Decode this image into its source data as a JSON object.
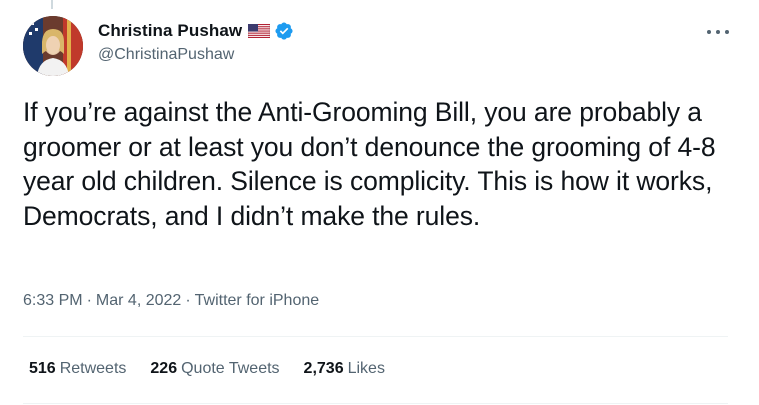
{
  "author": {
    "display_name": "Christina Pushaw",
    "handle": "@ChristinaPushaw",
    "flag": "us-flag-icon",
    "verified": "verified-badge-icon"
  },
  "tweet": {
    "text": "If you’re against the Anti-Grooming Bill, you are probably a groomer or at least you don’t denounce the grooming of 4-8 year old children. Silence is complicity. This is how it works, Democrats, and I didn’t make the rules.",
    "time": "6:33 PM",
    "separator": "·",
    "date": "Mar 4, 2022",
    "source": "Twitter for iPhone"
  },
  "stats": {
    "retweets": {
      "count": "516",
      "label": "Retweets"
    },
    "quotes": {
      "count": "226",
      "label": "Quote Tweets"
    },
    "likes": {
      "count": "2,736",
      "label": "Likes"
    }
  },
  "colors": {
    "text": "#0f1419",
    "secondary": "#536471",
    "verified": "#1d9bf0",
    "divider": "#eff3f4"
  }
}
